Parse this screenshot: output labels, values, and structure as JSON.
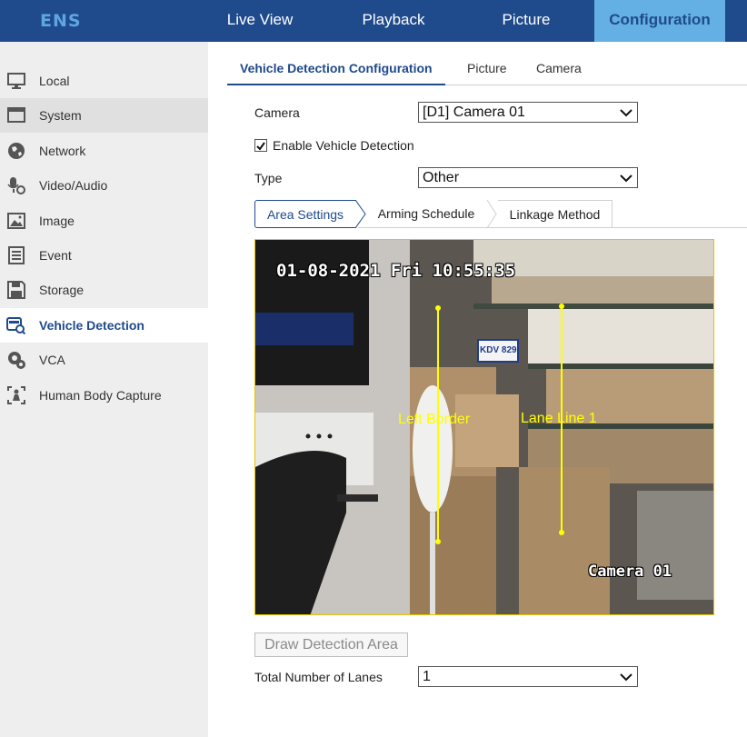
{
  "brand": {
    "logo": "ENS"
  },
  "topnav": [
    {
      "label": "Live View"
    },
    {
      "label": "Playback"
    },
    {
      "label": "Picture"
    },
    {
      "label": "Configuration"
    }
  ],
  "sidebar": {
    "items": [
      {
        "label": "Local",
        "icon": "monitor-icon"
      },
      {
        "label": "System",
        "icon": "window-icon"
      },
      {
        "label": "Network",
        "icon": "globe-icon"
      },
      {
        "label": "Video/Audio",
        "icon": "microphone-camera-icon"
      },
      {
        "label": "Image",
        "icon": "picture-icon"
      },
      {
        "label": "Event",
        "icon": "list-icon"
      },
      {
        "label": "Storage",
        "icon": "floppy-disk-icon"
      },
      {
        "label": "Vehicle Detection",
        "icon": "vehicle-search-icon"
      },
      {
        "label": "VCA",
        "icon": "camera-gear-icon"
      },
      {
        "label": "Human Body Capture",
        "icon": "human-scan-icon"
      }
    ]
  },
  "subtabs": [
    {
      "label": "Vehicle Detection Configuration"
    },
    {
      "label": "Picture"
    },
    {
      "label": "Camera"
    }
  ],
  "form": {
    "camera_label": "Camera",
    "camera_value": "[D1] Camera 01",
    "enable_label": "Enable Vehicle Detection",
    "enable_checked": true,
    "type_label": "Type",
    "type_value": "Other",
    "lanes_label": "Total Number of Lanes",
    "lanes_value": "1"
  },
  "steps": [
    {
      "label": "Area Settings"
    },
    {
      "label": "Arming Schedule"
    },
    {
      "label": "Linkage Method"
    }
  ],
  "video": {
    "timestamp": "01-08-2021 Fri 10:55:35",
    "camera_name": "Camera 01",
    "left_border_label": "Left Border",
    "lane_line_label": "Lane Line 1",
    "plate_text": "KDV 829"
  },
  "draw_button": "Draw Detection Area",
  "colors": {
    "header": "#1f4a8c",
    "active_tab": "#64b0e4",
    "overlay": "#ffff00"
  }
}
